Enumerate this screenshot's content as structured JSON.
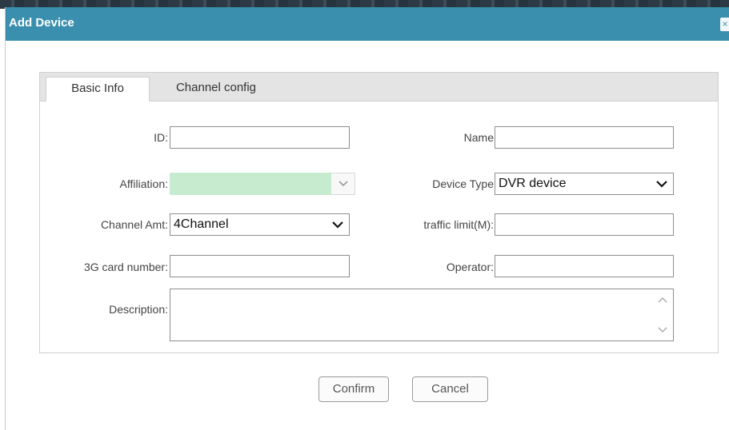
{
  "dialog": {
    "title": "Add Device",
    "close_label": "×"
  },
  "tabs": [
    {
      "label": "Basic Info",
      "active": true
    },
    {
      "label": "Channel config",
      "active": false
    }
  ],
  "form": {
    "id": {
      "label": "ID:",
      "value": ""
    },
    "name": {
      "label": "Name",
      "value": ""
    },
    "affiliation": {
      "label": "Affiliation:",
      "value": ""
    },
    "device_type": {
      "label": "Device Type",
      "value": "DVR device"
    },
    "channel_amt": {
      "label": "Channel Amt:",
      "value": "4Channel"
    },
    "traffic_limit": {
      "label": "traffic limit(M):",
      "value": ""
    },
    "card_number": {
      "label": "3G card number:",
      "value": ""
    },
    "operator": {
      "label": "Operator:",
      "value": ""
    },
    "description": {
      "label": "Description:",
      "value": ""
    }
  },
  "buttons": {
    "confirm": "Confirm",
    "cancel": "Cancel"
  },
  "colors": {
    "titlebar": "#3b8fae",
    "affiliation_fill": "#c6ebce"
  }
}
